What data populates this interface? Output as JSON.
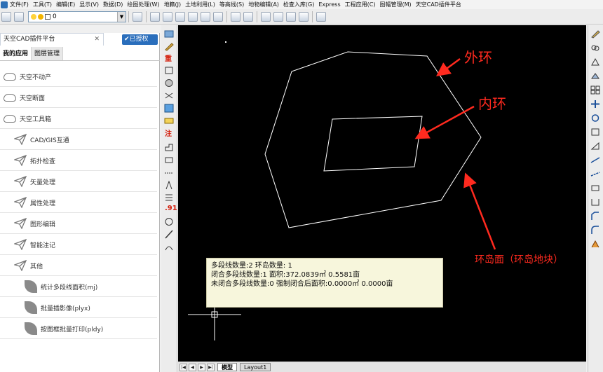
{
  "menubar": {
    "items": [
      "文件(F)",
      "工具(T)",
      "编辑(E)",
      "显示(V)",
      "数据(D)",
      "绘图处理(W)",
      "地籍(J)",
      "土地利用(L)",
      "等高线(S)",
      "地物编辑(A)",
      "检查入库(G)",
      "Express",
      "工程应用(C)",
      "图幅管理(M)",
      "天空CAD插件平台"
    ]
  },
  "toolbar": {
    "layer_value": "0"
  },
  "panel": {
    "tab_title": "天空CAD插件平台",
    "tab_close": "✕",
    "auth_badge": "✔已授权",
    "subtabs": [
      "我的应用",
      "图层管理"
    ],
    "items": [
      {
        "label": "天空不动产",
        "level": 0,
        "icon": "cloud-icon"
      },
      {
        "label": "天空断面",
        "level": 0,
        "icon": "cloud-icon"
      },
      {
        "label": "天空工具箱",
        "level": 0,
        "icon": "cloud-icon"
      },
      {
        "label": "CAD/GIS互通",
        "level": 1,
        "icon": "paper-plane-icon"
      },
      {
        "label": "拓扑检查",
        "level": 1,
        "icon": "paper-plane-icon"
      },
      {
        "label": "矢量处理",
        "level": 1,
        "icon": "paper-plane-icon"
      },
      {
        "label": "属性处理",
        "level": 1,
        "icon": "paper-plane-icon"
      },
      {
        "label": "图形编辑",
        "level": 1,
        "icon": "paper-plane-icon"
      },
      {
        "label": "智能注记",
        "level": 1,
        "icon": "paper-plane-icon"
      },
      {
        "label": "其他",
        "level": 1,
        "icon": "paper-plane-icon"
      },
      {
        "label": "统计多段线面积(mj)",
        "level": 2,
        "icon": "leaf-icon"
      },
      {
        "label": "批量插影像(plyx)",
        "level": 2,
        "icon": "leaf-icon"
      },
      {
        "label": "按图框批量打印(pldy)",
        "level": 2,
        "icon": "leaf-icon"
      }
    ]
  },
  "vstrip": {
    "label_zhong": "重",
    "label_zhu": "注",
    "label_91": ".91"
  },
  "canvas": {
    "annotations": {
      "outer_ring": "外环",
      "inner_ring": "内环",
      "island_face": "环岛面（环岛地块）"
    },
    "info_box": {
      "line1": "多段线数量:2 环岛数量: 1",
      "line2": "闭合多段线数量:1  面积:372.0839㎡  0.5581亩",
      "line3": "未闭合多段线数量:0  强制闭合后面积:0.0000㎡  0.0000亩"
    },
    "colors": {
      "background": "#000000",
      "annotation": "#ff2a1f",
      "polyline": "#ffffff"
    }
  },
  "layout_tabs": {
    "tabs": [
      "模型",
      "Layout1"
    ]
  }
}
